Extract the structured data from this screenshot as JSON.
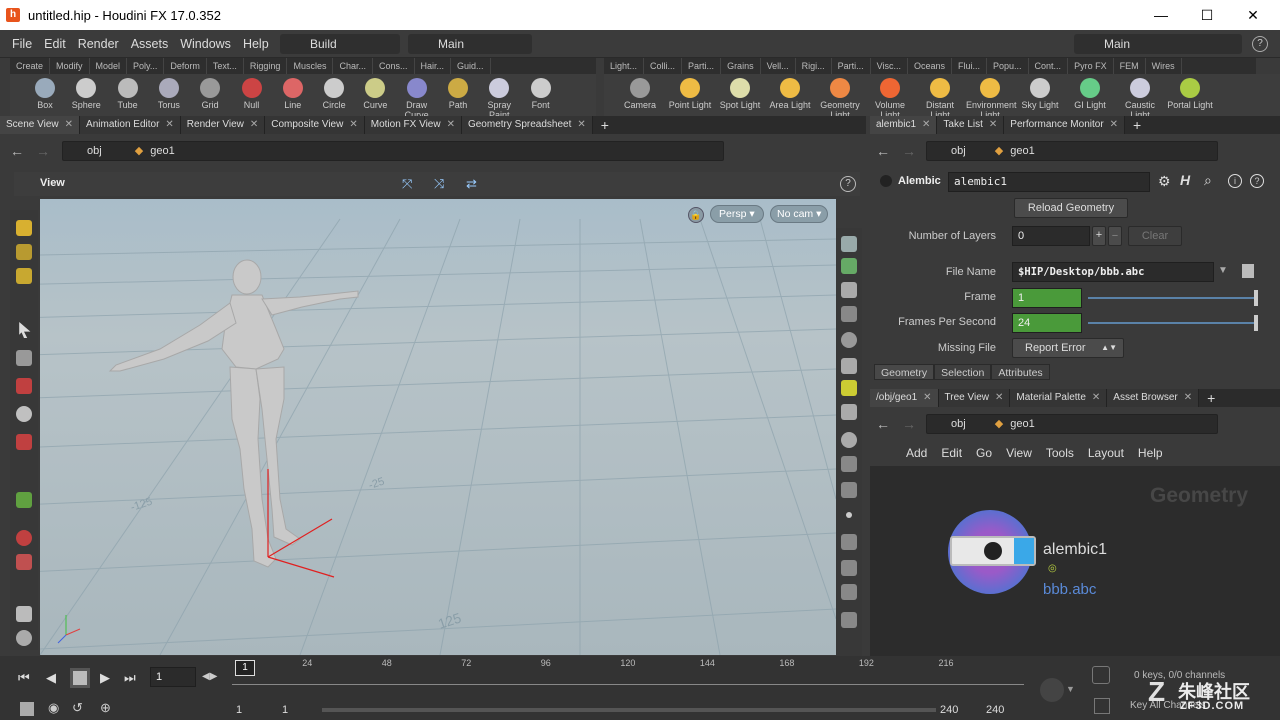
{
  "window": {
    "title": "untitled.hip - Houdini FX 17.0.352"
  },
  "menu": [
    "File",
    "Edit",
    "Render",
    "Assets",
    "Windows",
    "Help"
  ],
  "desktops": {
    "left": "Build",
    "middle": "Main",
    "right": "Main"
  },
  "shelf_left_tabs": [
    "Create",
    "Modify",
    "Model",
    "Poly...",
    "Deform",
    "Text...",
    "Rigging",
    "Muscles",
    "Char...",
    "Cons...",
    "Hair...",
    "Guid..."
  ],
  "shelf_right_tabs": [
    "Light...",
    "Colli...",
    "Parti...",
    "Grains",
    "Vell...",
    "Rigi...",
    "Parti...",
    "Visc...",
    "Oceans",
    "Flui...",
    "Popu...",
    "Cont...",
    "Pyro FX",
    "FEM",
    "Wires"
  ],
  "shelf_left_tools": [
    "Box",
    "Sphere",
    "Tube",
    "Torus",
    "Grid",
    "Null",
    "Line",
    "Circle",
    "Curve",
    "Draw Curve",
    "Path",
    "Spray Paint",
    "Font"
  ],
  "shelf_right_tools": [
    "Camera",
    "Point Light",
    "Spot Light",
    "Area Light",
    "Geometry Light",
    "Volume Light",
    "Distant Light",
    "Environment Light",
    "Sky Light",
    "GI Light",
    "Caustic Light",
    "Portal Light"
  ],
  "left_pane_tabs": [
    "Scene View",
    "Animation Editor",
    "Render View",
    "Composite View",
    "Motion FX View",
    "Geometry Spreadsheet"
  ],
  "path": {
    "root": "obj",
    "node": "geo1"
  },
  "viewport": {
    "header": "View",
    "persp": "Persp",
    "cam": "No cam",
    "grid_labels": [
      "125",
      "-125",
      "-25"
    ]
  },
  "param_tabs": [
    "alembic1",
    "Take List",
    "Performance Monitor"
  ],
  "params": {
    "type": "Alembic",
    "name": "alembic1",
    "reload_btn": "Reload Geometry",
    "layers_label": "Number of Layers",
    "layers_value": "0",
    "clear_btn": "Clear",
    "file_label": "File Name",
    "file_value": "$HIP/Desktop/bbb.abc",
    "frame_label": "Frame",
    "frame_value": "1",
    "fps_label": "Frames Per Second",
    "fps_value": "24",
    "missing_label": "Missing File",
    "missing_value": "Report Error",
    "subtabs": [
      "Geometry",
      "Selection",
      "Attributes"
    ]
  },
  "network_tabs": [
    "/obj/geo1",
    "Tree View",
    "Material Palette",
    "Asset Browser"
  ],
  "network_menu": [
    "Add",
    "Edit",
    "Go",
    "View",
    "Tools",
    "Layout",
    "Help"
  ],
  "network": {
    "context": "Geometry",
    "node_name": "alembic1",
    "node_sub": "bbb.abc"
  },
  "timeline": {
    "current_frame": "1",
    "start_marker": "1",
    "ticks": [
      "24",
      "48",
      "72",
      "96",
      "120",
      "144",
      "168",
      "192",
      "216"
    ],
    "range_start": "1",
    "range_start2": "1",
    "range_end": "240",
    "range_end2": "240",
    "keys_info": "0 keys, 0/0 channels",
    "key_all": "Key All Channels"
  },
  "watermark": {
    "brand": "朱峰社区",
    "site": "ZF3D.COM"
  },
  "colors": {
    "accent_green": "#4a9a3a",
    "node_blue": "#4b8ed0"
  }
}
